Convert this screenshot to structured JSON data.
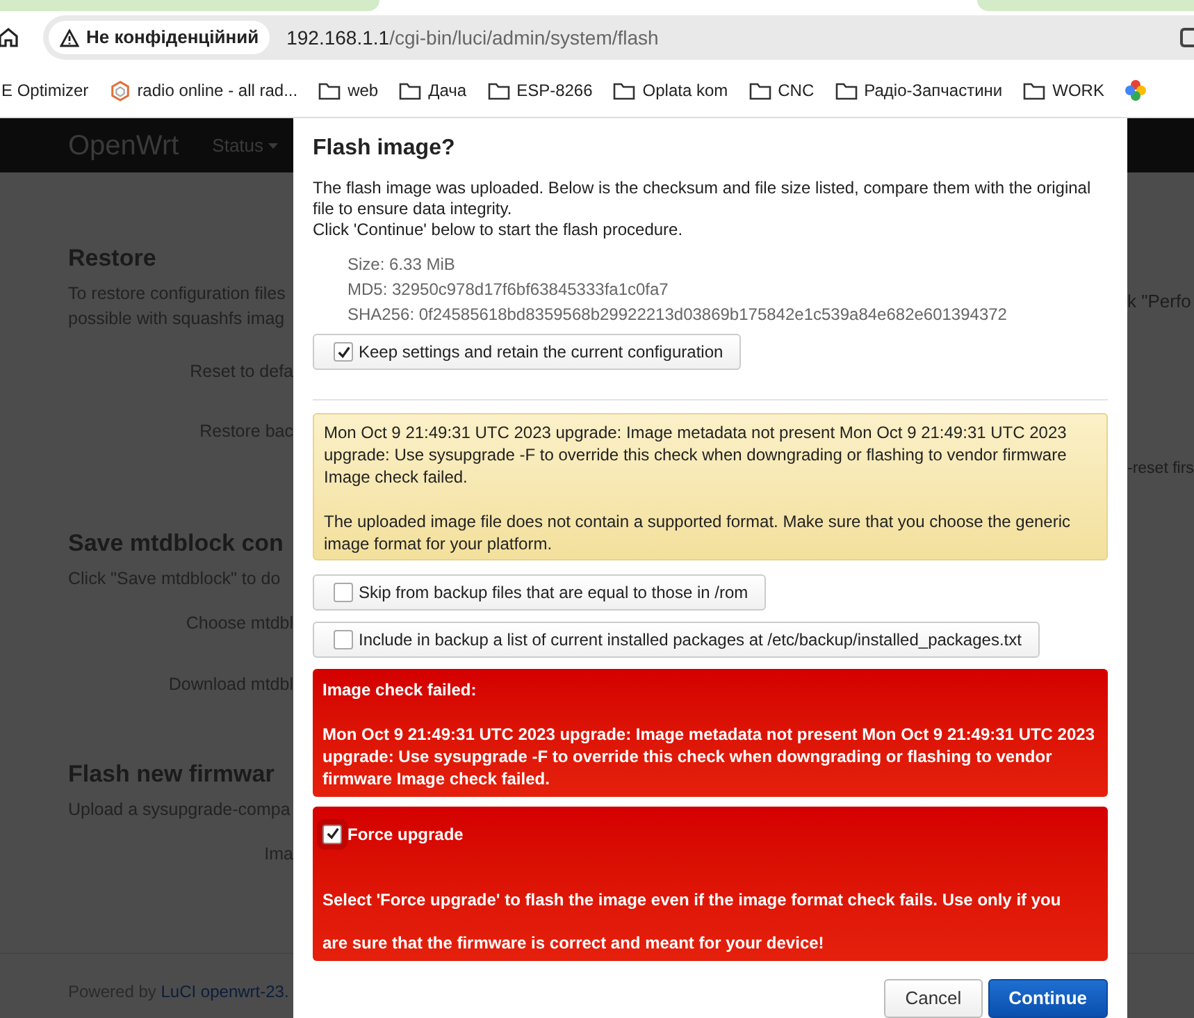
{
  "browser": {
    "security_label": "Не конфіденційний",
    "url_host": "192.168.1.1",
    "url_path": "/cgi-bin/luci/admin/system/flash",
    "bookmarks": [
      {
        "kind": "plain",
        "label": "E Optimizer"
      },
      {
        "kind": "site",
        "label": "radio online - all rad..."
      },
      {
        "kind": "folder",
        "label": "web"
      },
      {
        "kind": "folder",
        "label": "Дача"
      },
      {
        "kind": "folder",
        "label": "ESP-8266"
      },
      {
        "kind": "folder",
        "label": "Oplata kom"
      },
      {
        "kind": "folder",
        "label": "CNC"
      },
      {
        "kind": "folder",
        "label": "Радіо-Запчастини"
      },
      {
        "kind": "folder",
        "label": "WORK"
      },
      {
        "kind": "app"
      }
    ]
  },
  "page": {
    "brand": "OpenWrt",
    "nav": "Status",
    "sections": [
      {
        "title": "Restore",
        "text": [
          "To restore configuration files",
          "possible with squashfs imag"
        ],
        "fields": [
          "Reset to defa",
          "Restore bac"
        ]
      },
      {
        "title": "Save mtdblock con",
        "text": [
          "Click \"Save mtdblock\" to do"
        ],
        "fields": [
          "Choose mtdbl",
          "Download mtdbl"
        ]
      },
      {
        "title": "Flash new firmwar",
        "text": [
          "Upload a sysupgrade-compa"
        ],
        "fields": [
          "Ima"
        ]
      }
    ],
    "right_fragments": [
      "k \"Perfo",
      "-reset firs"
    ],
    "footer": {
      "prefix": "Powered by",
      "links": [
        "LuCI",
        "openwrt-23."
      ]
    }
  },
  "modal": {
    "title": "Flash image?",
    "intro": [
      "The flash image was uploaded. Below is the checksum and file size listed, compare them with the original file to ensure data integrity.",
      "Click 'Continue' below to start the flash procedure."
    ],
    "details": [
      "Size: 6.33 MiB",
      "MD5: 32950c978d17f6bf63845333fa1c0fa7",
      "SHA256: 0f24585618bd8359568b29922213d03869b175842e1c539a84e682e601394372"
    ],
    "keep": {
      "label": "Keep settings and retain the current configuration",
      "checked": true
    },
    "warning": [
      "Mon Oct 9 21:49:31 UTC 2023 upgrade: Image metadata not present Mon Oct 9 21:49:31 UTC 2023 upgrade: Use sysupgrade -F to override this check when downgrading or flashing to vendor firmware Image check failed.",
      "The uploaded image file does not contain a supported format. Make sure that you choose the generic image format for your platform."
    ],
    "options": [
      {
        "label": "Skip from backup files that are equal to those in /rom",
        "checked": false
      },
      {
        "label": "Include in backup a list of current installed packages at /etc/backup/installed_packages.txt",
        "checked": false
      }
    ],
    "error": {
      "title": "Image check failed:",
      "text": "Mon Oct 9 21:49:31 UTC 2023 upgrade: Image metadata not present Mon Oct 9 21:49:31 UTC 2023 upgrade: Use sysupgrade -F to override this check when downgrading or flashing to vendor firmware Image check failed."
    },
    "force": {
      "label": "Force upgrade",
      "checked": true,
      "text": [
        "Select 'Force upgrade' to flash the image even if the image format check fails. Use only if you",
        "are sure that the firmware is correct and meant for your device!"
      ]
    },
    "buttons": [
      {
        "kind": "secondary",
        "label": "Cancel"
      },
      {
        "kind": "primary",
        "label": "Continue"
      }
    ]
  }
}
